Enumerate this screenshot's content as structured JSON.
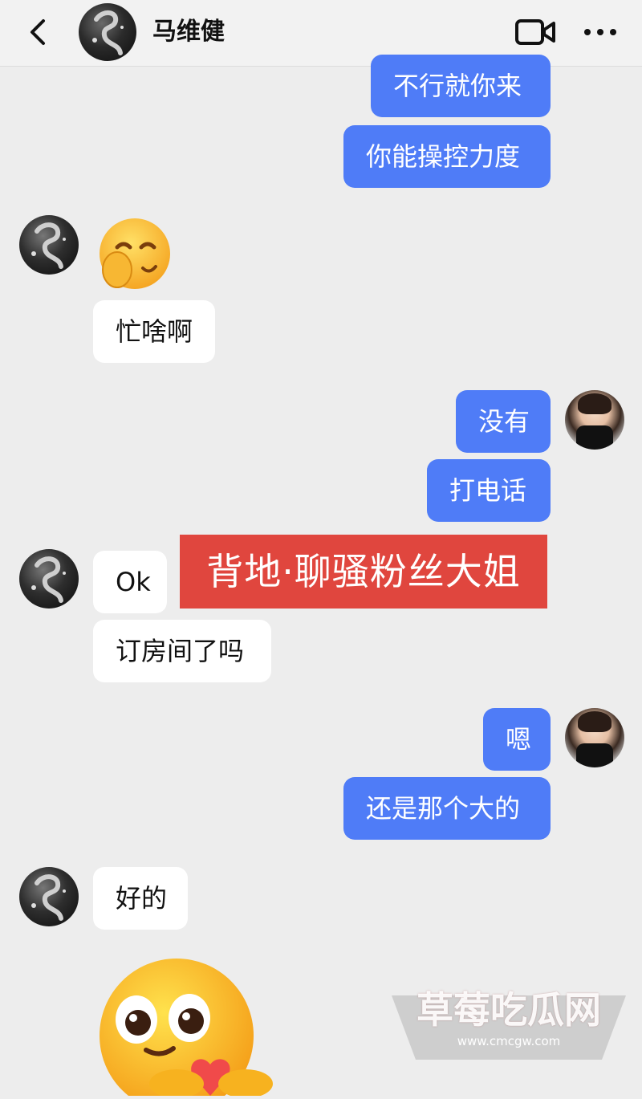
{
  "header": {
    "contact_name": "马维健",
    "icons": [
      "back-icon",
      "video-call-icon",
      "more-icon"
    ]
  },
  "messages": [
    {
      "side": "sent",
      "text": "不行就你来"
    },
    {
      "side": "sent",
      "text": "你能操控力度"
    },
    {
      "side": "received",
      "emoji": "covering-mouth-smile"
    },
    {
      "side": "received",
      "text": "忙啥啊"
    },
    {
      "side": "sent",
      "text": "没有"
    },
    {
      "side": "sent",
      "text": "打电话"
    },
    {
      "side": "received",
      "text": "Ok"
    },
    {
      "side": "received",
      "text": "订房间了吗"
    },
    {
      "side": "sent",
      "text": "嗯"
    },
    {
      "side": "sent",
      "text": "还是那个大的"
    },
    {
      "side": "received",
      "text": "好的"
    },
    {
      "side": "received",
      "emoji": "big-eyes-heart"
    }
  ],
  "overlay": {
    "banner_text": "背地·聊骚粉丝大姐",
    "banner_color": "#e0463e"
  },
  "watermark": {
    "title": "草莓吃瓜网",
    "url": "www.cmcgw.com"
  },
  "colors": {
    "sent_bubble": "#4f7cf7",
    "received_bubble": "#ffffff",
    "background": "#ededed"
  }
}
